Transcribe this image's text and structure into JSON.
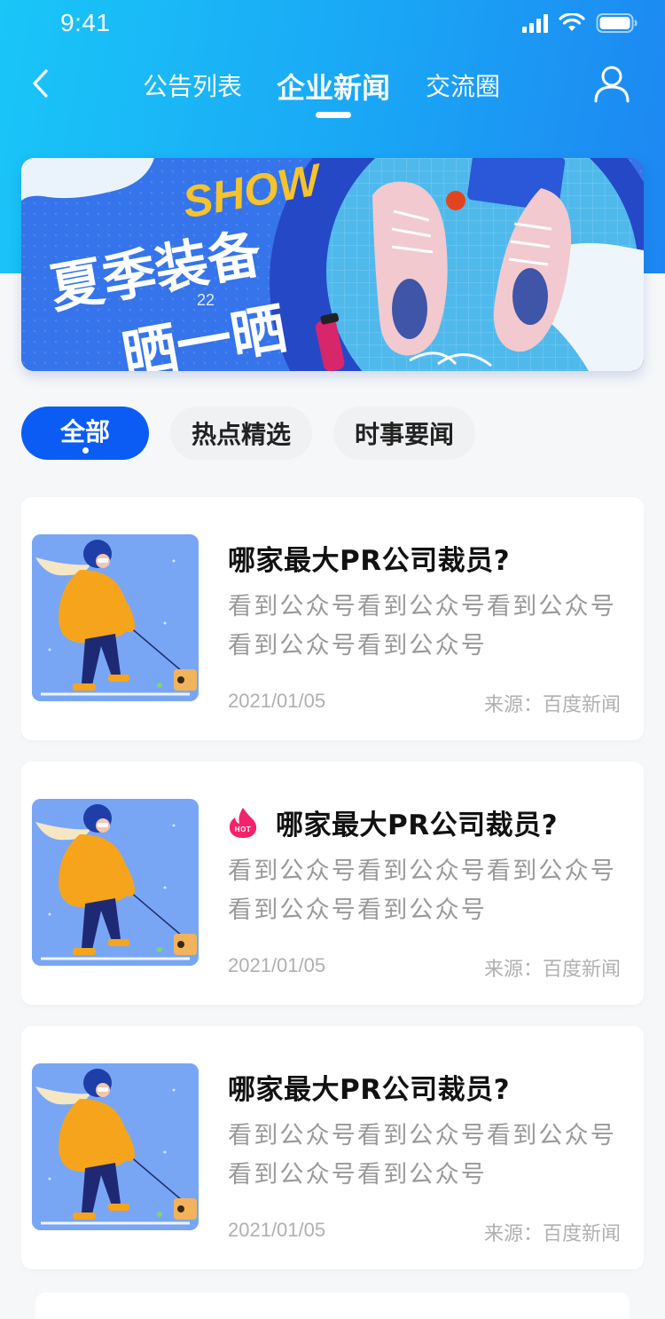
{
  "status_bar": {
    "time": "9:41"
  },
  "nav": {
    "tabs": [
      {
        "label": "公告列表"
      },
      {
        "label": "企业新闻"
      },
      {
        "label": "交流圈"
      }
    ],
    "active_tab": "企业新闻"
  },
  "banner": {
    "art_text": [
      "夏季装备",
      "晒一晒",
      "SHOW"
    ],
    "page_indicator": "22"
  },
  "filters": [
    {
      "label": "全部",
      "active": true
    },
    {
      "label": "热点精选",
      "active": false
    },
    {
      "label": "时事要闻",
      "active": false
    }
  ],
  "articles": [
    {
      "title": "哪家最大PR公司裁员?",
      "hot": false,
      "summary": "看到公众号看到公众号看到公众号看到公众号看到公众号",
      "date": "2021/01/05",
      "source": "来源：百度新闻"
    },
    {
      "title": "哪家最大PR公司裁员?",
      "hot": true,
      "hot_label": "HOT",
      "summary": "看到公众号看到公众号看到公众号看到公众号看到公众号",
      "date": "2021/01/05",
      "source": "来源：百度新闻"
    },
    {
      "title": "哪家最大PR公司裁员?",
      "hot": false,
      "summary": "看到公众号看到公众号看到公众号看到公众号看到公众号",
      "date": "2021/01/05",
      "source": "来源：百度新闻"
    }
  ],
  "colors": {
    "header_gradient_start": "#19c6f8",
    "header_gradient_end": "#1d86f2",
    "accent": "#0a5cf5",
    "hot": "#f5226b"
  },
  "icons": [
    "back-arrow-icon",
    "user-icon",
    "signal-icon",
    "wifi-icon",
    "battery-icon",
    "hot-flame-icon"
  ]
}
